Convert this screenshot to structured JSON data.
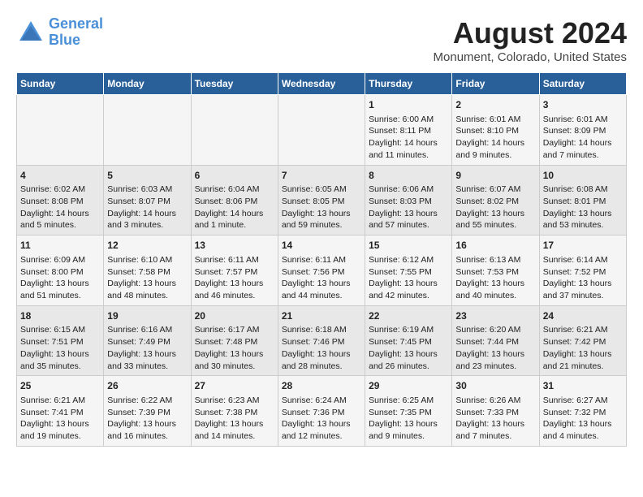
{
  "header": {
    "logo_line1": "General",
    "logo_line2": "Blue",
    "month_year": "August 2024",
    "location": "Monument, Colorado, United States"
  },
  "days_of_week": [
    "Sunday",
    "Monday",
    "Tuesday",
    "Wednesday",
    "Thursday",
    "Friday",
    "Saturday"
  ],
  "weeks": [
    [
      {
        "day": "",
        "info": ""
      },
      {
        "day": "",
        "info": ""
      },
      {
        "day": "",
        "info": ""
      },
      {
        "day": "",
        "info": ""
      },
      {
        "day": "1",
        "info": "Sunrise: 6:00 AM\nSunset: 8:11 PM\nDaylight: 14 hours\nand 11 minutes."
      },
      {
        "day": "2",
        "info": "Sunrise: 6:01 AM\nSunset: 8:10 PM\nDaylight: 14 hours\nand 9 minutes."
      },
      {
        "day": "3",
        "info": "Sunrise: 6:01 AM\nSunset: 8:09 PM\nDaylight: 14 hours\nand 7 minutes."
      }
    ],
    [
      {
        "day": "4",
        "info": "Sunrise: 6:02 AM\nSunset: 8:08 PM\nDaylight: 14 hours\nand 5 minutes."
      },
      {
        "day": "5",
        "info": "Sunrise: 6:03 AM\nSunset: 8:07 PM\nDaylight: 14 hours\nand 3 minutes."
      },
      {
        "day": "6",
        "info": "Sunrise: 6:04 AM\nSunset: 8:06 PM\nDaylight: 14 hours\nand 1 minute."
      },
      {
        "day": "7",
        "info": "Sunrise: 6:05 AM\nSunset: 8:05 PM\nDaylight: 13 hours\nand 59 minutes."
      },
      {
        "day": "8",
        "info": "Sunrise: 6:06 AM\nSunset: 8:03 PM\nDaylight: 13 hours\nand 57 minutes."
      },
      {
        "day": "9",
        "info": "Sunrise: 6:07 AM\nSunset: 8:02 PM\nDaylight: 13 hours\nand 55 minutes."
      },
      {
        "day": "10",
        "info": "Sunrise: 6:08 AM\nSunset: 8:01 PM\nDaylight: 13 hours\nand 53 minutes."
      }
    ],
    [
      {
        "day": "11",
        "info": "Sunrise: 6:09 AM\nSunset: 8:00 PM\nDaylight: 13 hours\nand 51 minutes."
      },
      {
        "day": "12",
        "info": "Sunrise: 6:10 AM\nSunset: 7:58 PM\nDaylight: 13 hours\nand 48 minutes."
      },
      {
        "day": "13",
        "info": "Sunrise: 6:11 AM\nSunset: 7:57 PM\nDaylight: 13 hours\nand 46 minutes."
      },
      {
        "day": "14",
        "info": "Sunrise: 6:11 AM\nSunset: 7:56 PM\nDaylight: 13 hours\nand 44 minutes."
      },
      {
        "day": "15",
        "info": "Sunrise: 6:12 AM\nSunset: 7:55 PM\nDaylight: 13 hours\nand 42 minutes."
      },
      {
        "day": "16",
        "info": "Sunrise: 6:13 AM\nSunset: 7:53 PM\nDaylight: 13 hours\nand 40 minutes."
      },
      {
        "day": "17",
        "info": "Sunrise: 6:14 AM\nSunset: 7:52 PM\nDaylight: 13 hours\nand 37 minutes."
      }
    ],
    [
      {
        "day": "18",
        "info": "Sunrise: 6:15 AM\nSunset: 7:51 PM\nDaylight: 13 hours\nand 35 minutes."
      },
      {
        "day": "19",
        "info": "Sunrise: 6:16 AM\nSunset: 7:49 PM\nDaylight: 13 hours\nand 33 minutes."
      },
      {
        "day": "20",
        "info": "Sunrise: 6:17 AM\nSunset: 7:48 PM\nDaylight: 13 hours\nand 30 minutes."
      },
      {
        "day": "21",
        "info": "Sunrise: 6:18 AM\nSunset: 7:46 PM\nDaylight: 13 hours\nand 28 minutes."
      },
      {
        "day": "22",
        "info": "Sunrise: 6:19 AM\nSunset: 7:45 PM\nDaylight: 13 hours\nand 26 minutes."
      },
      {
        "day": "23",
        "info": "Sunrise: 6:20 AM\nSunset: 7:44 PM\nDaylight: 13 hours\nand 23 minutes."
      },
      {
        "day": "24",
        "info": "Sunrise: 6:21 AM\nSunset: 7:42 PM\nDaylight: 13 hours\nand 21 minutes."
      }
    ],
    [
      {
        "day": "25",
        "info": "Sunrise: 6:21 AM\nSunset: 7:41 PM\nDaylight: 13 hours\nand 19 minutes."
      },
      {
        "day": "26",
        "info": "Sunrise: 6:22 AM\nSunset: 7:39 PM\nDaylight: 13 hours\nand 16 minutes."
      },
      {
        "day": "27",
        "info": "Sunrise: 6:23 AM\nSunset: 7:38 PM\nDaylight: 13 hours\nand 14 minutes."
      },
      {
        "day": "28",
        "info": "Sunrise: 6:24 AM\nSunset: 7:36 PM\nDaylight: 13 hours\nand 12 minutes."
      },
      {
        "day": "29",
        "info": "Sunrise: 6:25 AM\nSunset: 7:35 PM\nDaylight: 13 hours\nand 9 minutes."
      },
      {
        "day": "30",
        "info": "Sunrise: 6:26 AM\nSunset: 7:33 PM\nDaylight: 13 hours\nand 7 minutes."
      },
      {
        "day": "31",
        "info": "Sunrise: 6:27 AM\nSunset: 7:32 PM\nDaylight: 13 hours\nand 4 minutes."
      }
    ]
  ]
}
